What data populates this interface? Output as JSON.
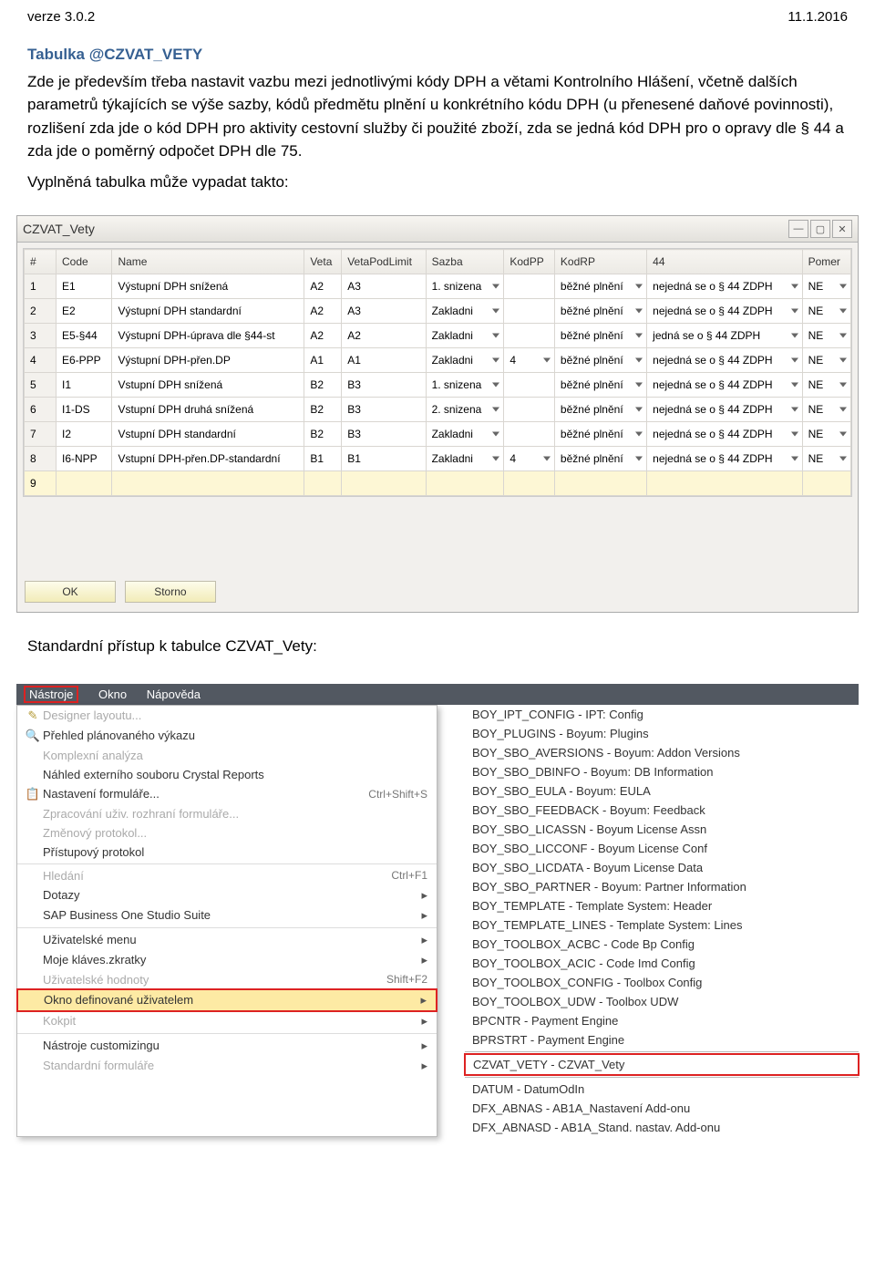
{
  "header": {
    "left": "verze 3.0.2",
    "right": "11.1.2016"
  },
  "section": {
    "title": "Tabulka @CZVAT_VETY",
    "paragraph": "Zde je především třeba nastavit vazbu mezi jednotlivými kódy DPH a větami Kontrolního Hlášení, včetně dalších parametrů týkajících se výše sazby, kódů předmětu plnění u konkrétního kódu DPH (u přenesené daňové povinnosti), rozlišení zda jde o kód DPH pro aktivity cestovní služby či použité zboží, zda se jedná kód DPH pro o opravy dle § 44 a zda jde o poměrný odpočet DPH dle 75.",
    "caption1": "Vyplněná tabulka může vypadat takto:",
    "caption2": "Standardní přístup k tabulce CZVAT_Vety:"
  },
  "table": {
    "title": "CZVAT_Vety",
    "headers": [
      "#",
      "Code",
      "Name",
      "Veta",
      "VetaPodLimit",
      "Sazba",
      "KodPP",
      "KodRP",
      "44",
      "Pomer"
    ],
    "rows": [
      {
        "n": "1",
        "code": "E1",
        "name": "Výstupní DPH snížená",
        "veta": "A2",
        "vpl": "A3",
        "sazba": "1. snizena",
        "kodpp": "",
        "kodrp": "běžné plnění",
        "c44": "nejedná se o § 44 ZDPH",
        "pomer": "NE"
      },
      {
        "n": "2",
        "code": "E2",
        "name": "Výstupní DPH standardní",
        "veta": "A2",
        "vpl": "A3",
        "sazba": "Zakladni",
        "kodpp": "",
        "kodrp": "běžné plnění",
        "c44": "nejedná se o § 44 ZDPH",
        "pomer": "NE"
      },
      {
        "n": "3",
        "code": "E5-§44",
        "name": "Výstupní DPH-úprava dle §44-st",
        "veta": "A2",
        "vpl": "A2",
        "sazba": "Zakladni",
        "kodpp": "",
        "kodrp": "běžné plnění",
        "c44": "jedná se o § 44 ZDPH",
        "pomer": "NE"
      },
      {
        "n": "4",
        "code": "E6-PPP",
        "name": "Výstupní DPH-přen.DP",
        "veta": "A1",
        "vpl": "A1",
        "sazba": "Zakladni",
        "kodpp": "4",
        "kodrp": "běžné plnění",
        "c44": "nejedná se o § 44 ZDPH",
        "pomer": "NE"
      },
      {
        "n": "5",
        "code": "I1",
        "name": "Vstupní DPH snížená",
        "veta": "B2",
        "vpl": "B3",
        "sazba": "1. snizena",
        "kodpp": "",
        "kodrp": "běžné plnění",
        "c44": "nejedná se o § 44 ZDPH",
        "pomer": "NE"
      },
      {
        "n": "6",
        "code": "I1-DS",
        "name": "Vstupní DPH druhá snížená",
        "veta": "B2",
        "vpl": "B3",
        "sazba": "2. snizena",
        "kodpp": "",
        "kodrp": "běžné plnění",
        "c44": "nejedná se o § 44 ZDPH",
        "pomer": "NE"
      },
      {
        "n": "7",
        "code": "I2",
        "name": "Vstupní DPH standardní",
        "veta": "B2",
        "vpl": "B3",
        "sazba": "Zakladni",
        "kodpp": "",
        "kodrp": "běžné plnění",
        "c44": "nejedná se o § 44 ZDPH",
        "pomer": "NE"
      },
      {
        "n": "8",
        "code": "I6-NPP",
        "name": "Vstupní DPH-přen.DP-standardní",
        "veta": "B1",
        "vpl": "B1",
        "sazba": "Zakladni",
        "kodpp": "4",
        "kodrp": "běžné plnění",
        "c44": "nejedná se o § 44 ZDPH",
        "pomer": "NE"
      },
      {
        "n": "9",
        "code": "",
        "name": "",
        "veta": "",
        "vpl": "",
        "sazba": "",
        "kodpp": "",
        "kodrp": "",
        "c44": "",
        "pomer": ""
      }
    ],
    "buttons": {
      "ok": "OK",
      "storno": "Storno"
    }
  },
  "menubar": {
    "tools": "Nástroje",
    "window": "Okno",
    "help": "Nápověda"
  },
  "menu": [
    {
      "label": "Designer layoutu...",
      "icon": "✎",
      "disabled": true
    },
    {
      "label": "Přehled plánovaného výkazu",
      "icon": "🔍",
      "disabled": false
    },
    {
      "label": "Komplexní analýza",
      "disabled": true
    },
    {
      "label": "Náhled externího souboru Crystal Reports",
      "disabled": false
    },
    {
      "label": "Nastavení formuláře...",
      "icon": "📋",
      "shortcut": "Ctrl+Shift+S",
      "disabled": false
    },
    {
      "label": "Zpracování uživ. rozhraní formuláře...",
      "disabled": true
    },
    {
      "label": "Změnový protokol...",
      "disabled": true
    },
    {
      "label": "Přístupový protokol",
      "disabled": false
    },
    {
      "sep": true
    },
    {
      "label": "Hledání",
      "shortcut": "Ctrl+F1",
      "disabled": true
    },
    {
      "label": "Dotazy",
      "arrow": true,
      "disabled": false
    },
    {
      "label": "SAP Business One Studio Suite",
      "arrow": true,
      "disabled": false
    },
    {
      "sep": true
    },
    {
      "label": "Uživatelské menu",
      "arrow": true,
      "disabled": false
    },
    {
      "label": "Moje kláves.zkratky",
      "arrow": true,
      "disabled": false
    },
    {
      "label": "Uživatelské hodnoty",
      "shortcut": "Shift+F2",
      "disabled": true
    },
    {
      "label": "Okno definované uživatelem",
      "arrow": true,
      "hl": true,
      "disabled": false
    },
    {
      "label": "Kokpit",
      "arrow": true,
      "disabled": true
    },
    {
      "sep": true
    },
    {
      "label": "Nástroje customizingu",
      "arrow": true,
      "disabled": false
    },
    {
      "label": "Standardní formuláře",
      "arrow": true,
      "disabled": true
    }
  ],
  "sublist": [
    "BOY_IPT_CONFIG - IPT: Config",
    "BOY_PLUGINS - Boyum: Plugins",
    "BOY_SBO_AVERSIONS - Boyum: Addon Versions",
    "BOY_SBO_DBINFO - Boyum: DB Information",
    "BOY_SBO_EULA - Boyum: EULA",
    "BOY_SBO_FEEDBACK - Boyum: Feedback",
    "BOY_SBO_LICASSN - Boyum License Assn",
    "BOY_SBO_LICCONF - Boyum License Conf",
    "BOY_SBO_LICDATA - Boyum License Data",
    "BOY_SBO_PARTNER - Boyum: Partner Information",
    "BOY_TEMPLATE - Template System: Header",
    "BOY_TEMPLATE_LINES - Template System: Lines",
    "BOY_TOOLBOX_ACBC - Code Bp Config",
    "BOY_TOOLBOX_ACIC - Code Imd Config",
    "BOY_TOOLBOX_CONFIG - Toolbox Config",
    "BOY_TOOLBOX_UDW - Toolbox UDW",
    "BPCNTR - Payment Engine",
    "BPRSTRT - Payment Engine",
    "CZVAT_VETY - CZVAT_Vety",
    "DATUM - DatumOdIn",
    "DFX_ABNAS - AB1A_Nastavení Add-onu",
    "DFX_ABNASD - AB1A_Stand. nastav. Add-onu"
  ],
  "sublist_hl_index": 18
}
